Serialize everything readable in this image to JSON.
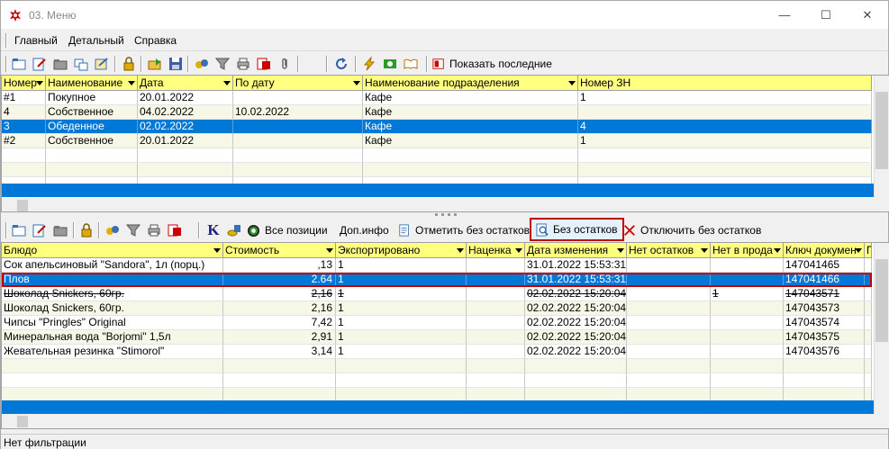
{
  "window": {
    "title": "03. Меню",
    "min_glyph": "—",
    "max_glyph": "☐",
    "close_glyph": "✕"
  },
  "menu": {
    "items": [
      "Главный",
      "Детальный",
      "Справка"
    ]
  },
  "toolbar_top": {
    "show_last_label": "Показать последние"
  },
  "upper_grid": {
    "columns": [
      "Номер",
      "Наименование",
      "Дата",
      "По дату",
      "Наименование подразделения",
      "Номер ЗН"
    ],
    "rows": [
      [
        "#1",
        "Покупное",
        "20.01.2022",
        "",
        "Кафе",
        "1"
      ],
      [
        "4",
        "Собственное",
        "04.02.2022",
        "10.02.2022",
        "Кафе",
        ""
      ],
      [
        "3",
        "Обеденное",
        "02.02.2022",
        "",
        "Кафе",
        "4"
      ],
      [
        "#2",
        "Собственное",
        "20.01.2022",
        "",
        "Кафе",
        "1"
      ]
    ],
    "selected_row": 2
  },
  "toolbar_bottom": {
    "k_label": "K",
    "all_positions_label": "Все позиции",
    "dop_info_label": "Доп.инфо",
    "mark_no_rest_label": "Отметить без остатков",
    "no_rest_label": "Без остатков",
    "disable_no_rest_label": "Отключить без остатков"
  },
  "lower_grid": {
    "columns": [
      "Блюдо",
      "Стоимость",
      "Экспортировано",
      "Наценка",
      "Дата изменения",
      "Нет остатков",
      "Нет в прода",
      "Ключ докумен",
      "П"
    ],
    "rows": [
      [
        "Сок апельсиновый \"Sandora\", 1л (порц.)",
        ",13",
        "1",
        "",
        "31.01.2022 15:53:31",
        "",
        "",
        "147041465"
      ],
      [
        "Плов",
        "2.64",
        "1",
        "",
        "31.01.2022 15:53:31",
        "",
        "",
        "147041466"
      ],
      [
        "Шоколад Snickers, 60гр.",
        "2,16",
        "1",
        "",
        "02.02.2022 15:20:04",
        "",
        "1",
        "147043571"
      ],
      [
        "Шоколад Snickers, 60гр.",
        "2,16",
        "1",
        "",
        "02.02.2022 15:20:04",
        "",
        "",
        "147043573"
      ],
      [
        "Чипсы \"Pringles\" Original",
        "7,42",
        "1",
        "",
        "02.02.2022 15:20:04",
        "",
        "",
        "147043574"
      ],
      [
        "Минеральная вода \"Borjomi\" 1,5л",
        "2,91",
        "1",
        "",
        "02.02.2022 15:20:04",
        "",
        "",
        "147043575"
      ],
      [
        "Жевательная резинка \"Stimorol\"",
        "3,14",
        "1",
        "",
        "02.02.2022 15:20:04",
        "",
        "",
        "147043576"
      ]
    ],
    "selected_row": 1,
    "struck_row": 2
  },
  "status": {
    "text": "Нет фильтрации"
  },
  "colors": {
    "header": "#ffff80",
    "selection": "#0078d7",
    "highlight_border": "#c00000"
  }
}
